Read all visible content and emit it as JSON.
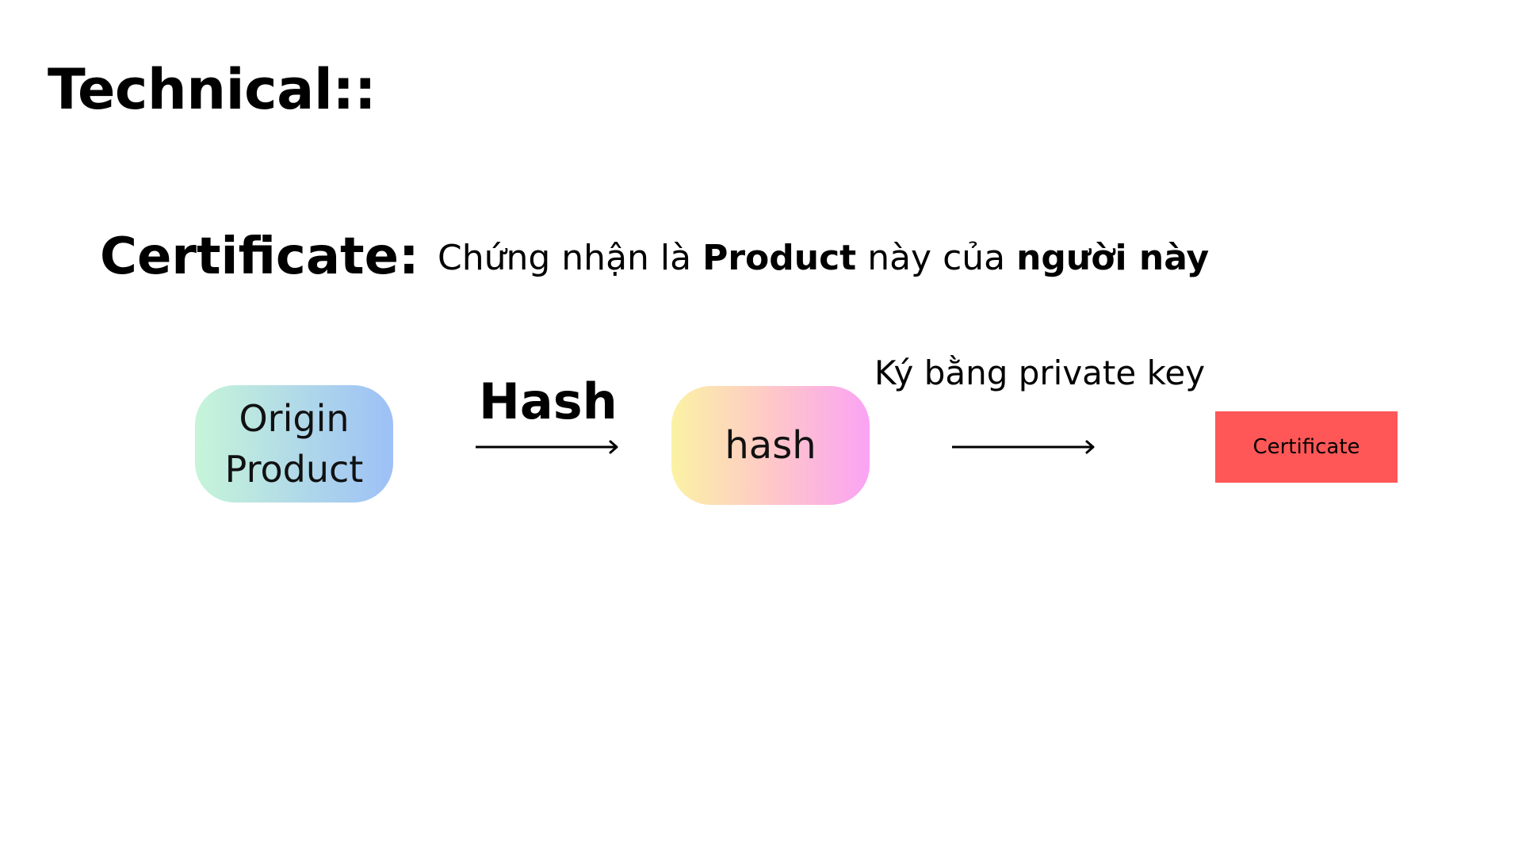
{
  "slide": {
    "title": "Technical::",
    "certificate_heading": "Certificate:",
    "certificate_desc": {
      "part1": "Chứng nhận là ",
      "bold1": "Product",
      "part2": " này của ",
      "bold2": "người này"
    }
  },
  "diagram": {
    "nodes": {
      "origin": {
        "line1": "Origin",
        "line2": "Product"
      },
      "hash": {
        "label": "hash"
      },
      "certificate": {
        "label": "Certificate"
      }
    },
    "edges": {
      "hash_label": "Hash",
      "sign_label": "Ký bằng private key"
    }
  },
  "colors": {
    "certificate_fill": "#ff5757",
    "origin_gradient": [
      "#c6f5d8",
      "#9dc0f7"
    ],
    "hash_gradient": [
      "#fbf2a4",
      "#fec8c8",
      "#fba3f4"
    ]
  }
}
